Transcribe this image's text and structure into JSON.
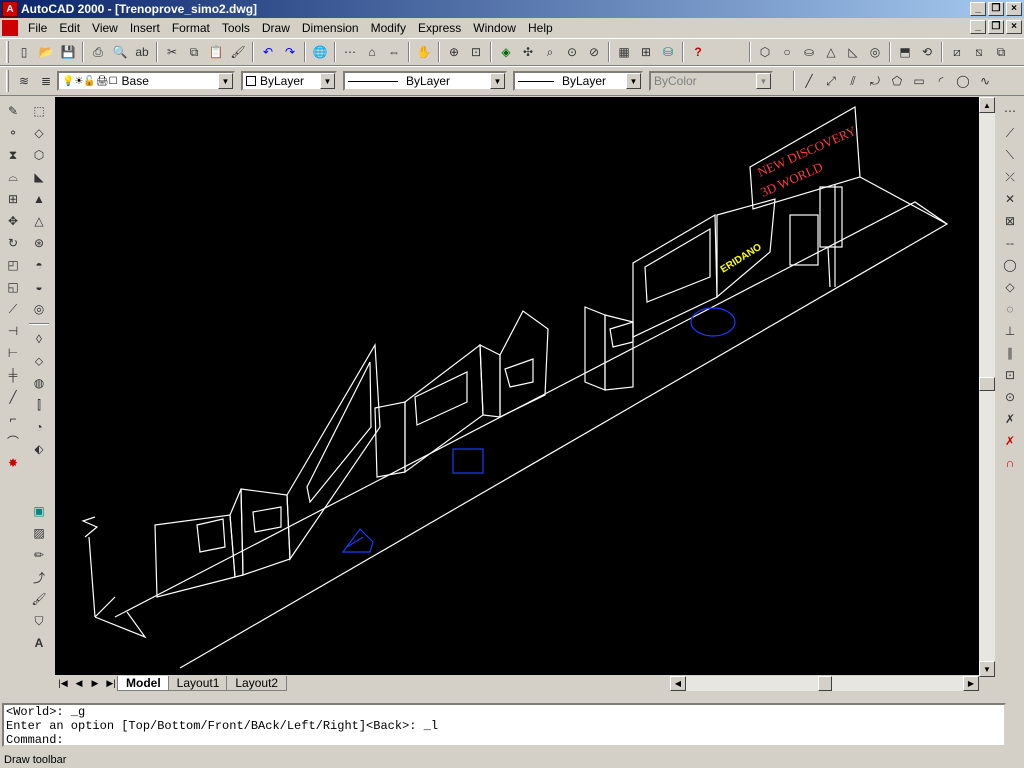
{
  "window": {
    "title": "AutoCAD 2000 - [Trenoprove_simo2.dwg]"
  },
  "menu": [
    "File",
    "Edit",
    "View",
    "Insert",
    "Format",
    "Tools",
    "Draw",
    "Dimension",
    "Modify",
    "Express",
    "Window",
    "Help"
  ],
  "properties_toolbar": {
    "layer_value": "Base",
    "color_value": "ByLayer",
    "linetype_value": "ByLayer",
    "lineweight_value": "ByLayer",
    "plotstyle_value": "ByColor"
  },
  "drawing": {
    "sign_text_1": "NEW DISCOVERY",
    "sign_text_2": "3D WORLD",
    "label_text": "ERIDANO"
  },
  "tabs": {
    "model": "Model",
    "layout1": "Layout1",
    "layout2": "Layout2"
  },
  "command": {
    "line1": "<World>: _g",
    "line2": "Enter an option [Top/Bottom/Front/BAck/Left/Right]<Back>: _l",
    "line3": "Command:"
  },
  "status": {
    "text": "Draw toolbar"
  },
  "colors": {
    "title_gradient_start": "#0a246a",
    "title_gradient_end": "#a6caf0",
    "chrome": "#d4d0c8",
    "canvas": "#000000",
    "wireframe": "#ffffff",
    "blue_objects": "#1a3cff",
    "sign_text": "#ff3b3b",
    "label_yellow": "#ffff00"
  }
}
